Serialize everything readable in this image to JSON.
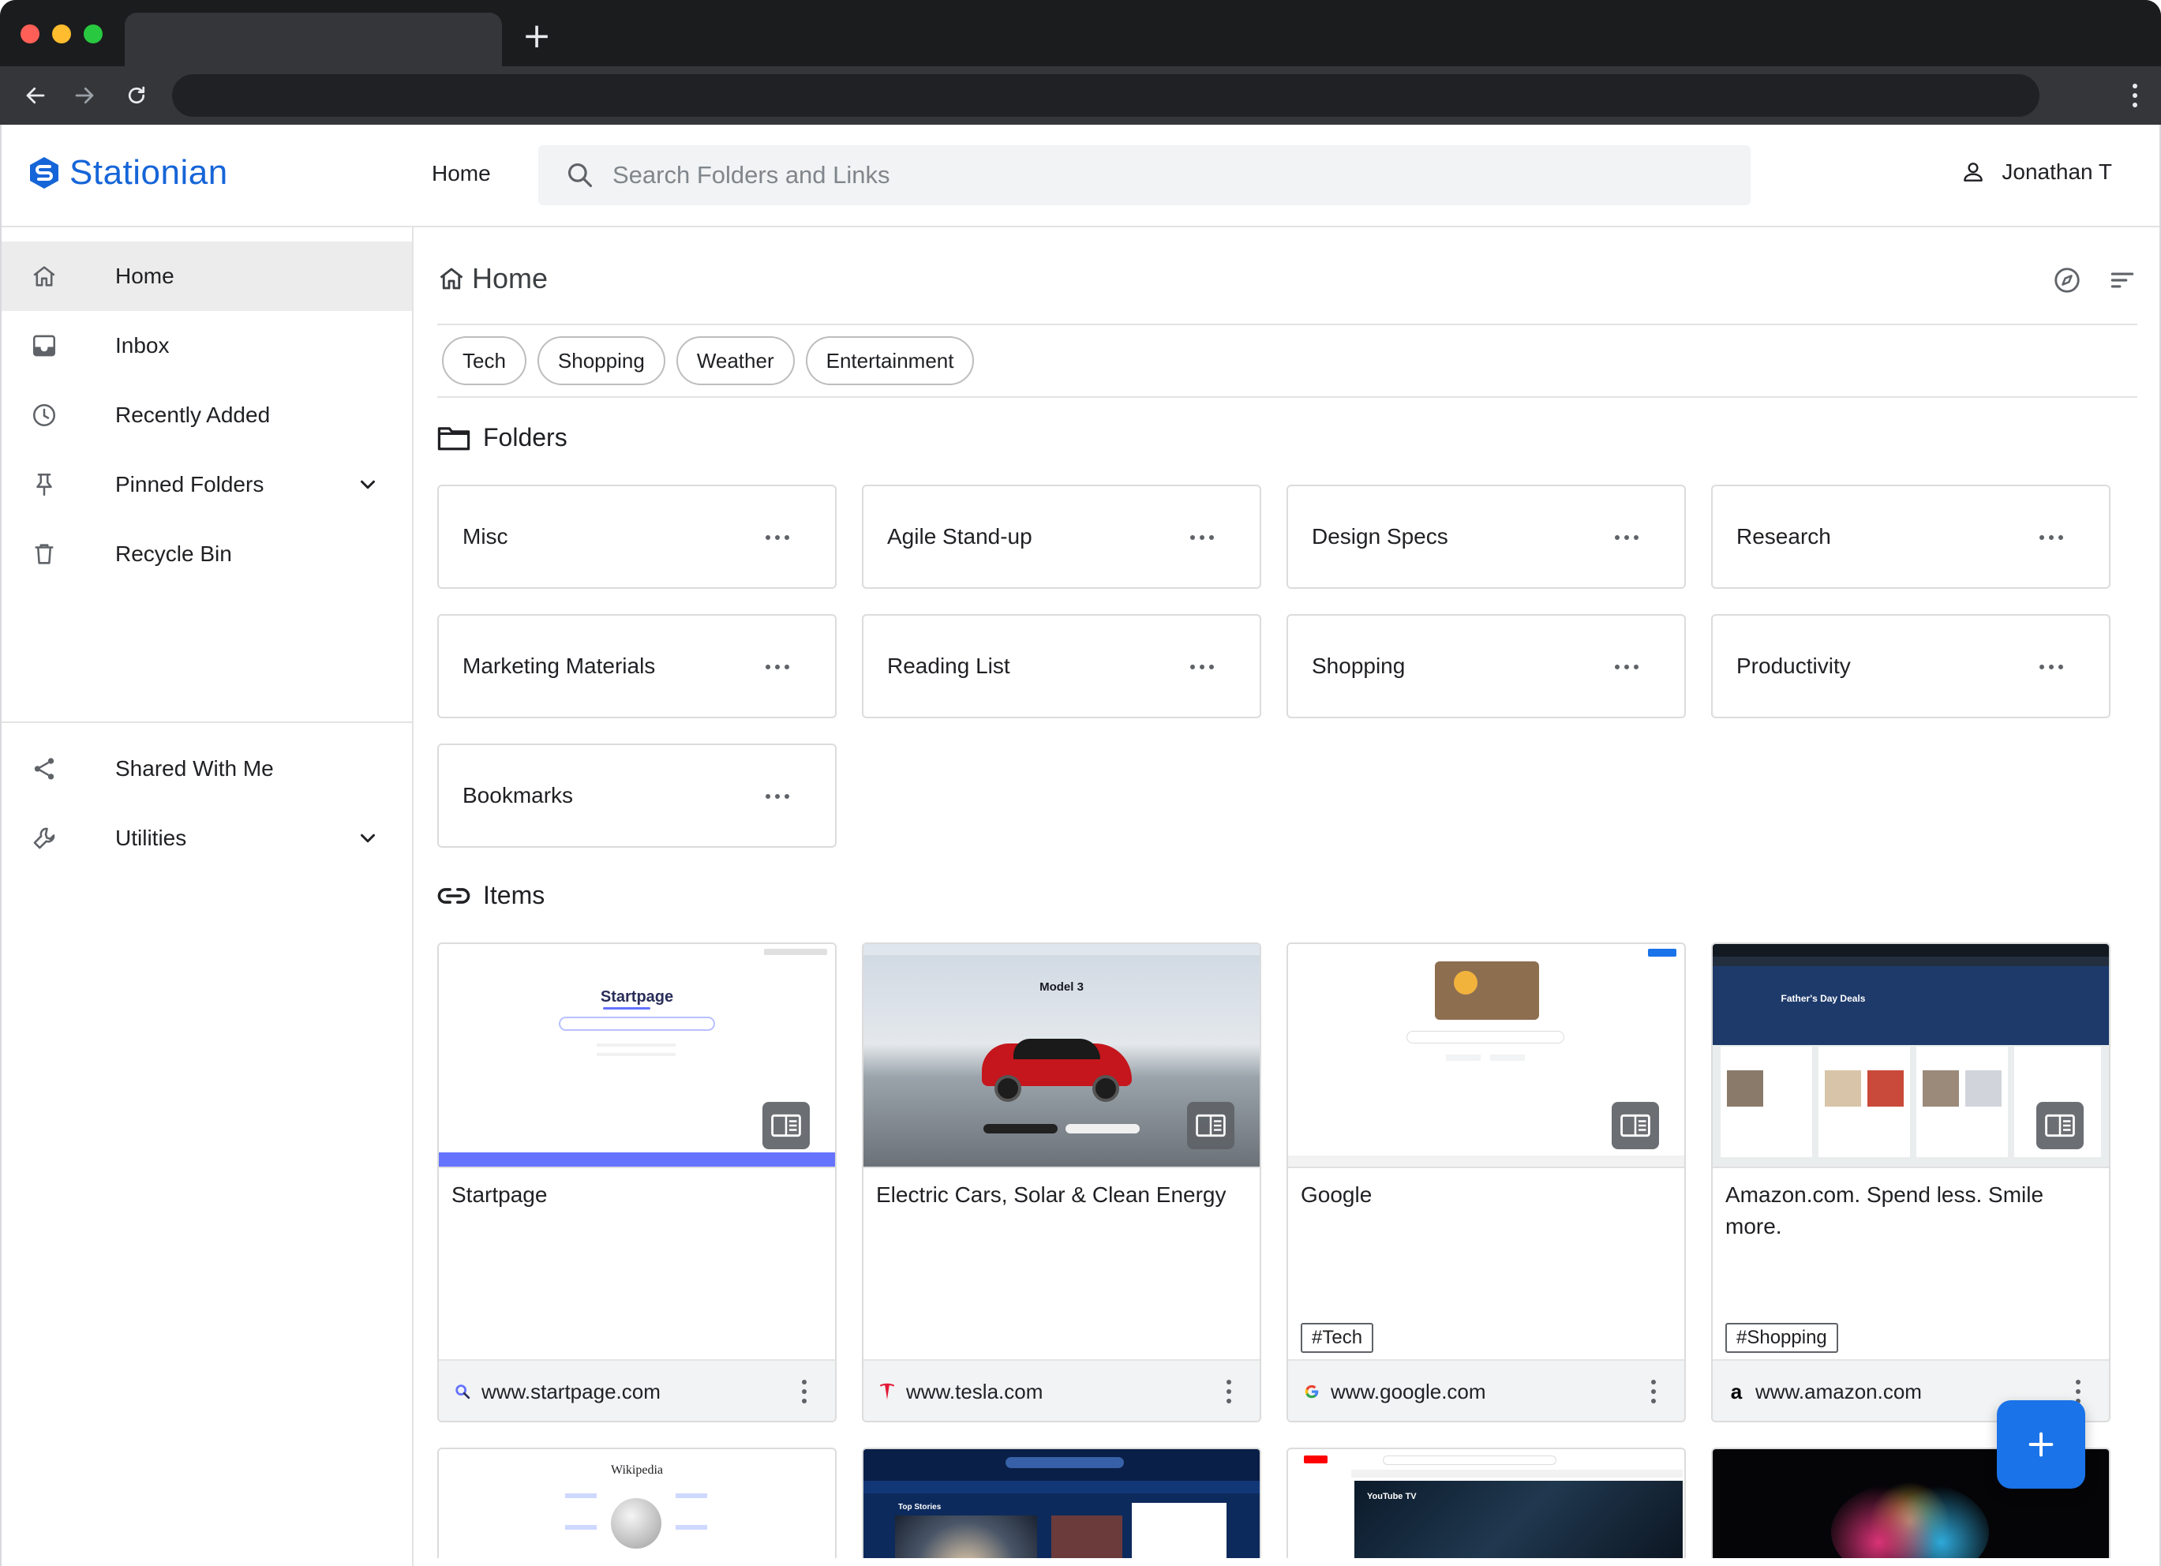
{
  "app": {
    "name": "Stationian",
    "accent": "#1665d8"
  },
  "header": {
    "nav_home": "Home",
    "search_placeholder": "Search Folders and Links",
    "user_name": "Jonathan T"
  },
  "sidebar": {
    "items": [
      {
        "label": "Home",
        "icon": "home-icon",
        "active": true
      },
      {
        "label": "Inbox",
        "icon": "inbox-icon"
      },
      {
        "label": "Recently Added",
        "icon": "clock-icon"
      },
      {
        "label": "Pinned Folders",
        "icon": "pin-icon",
        "expandable": true
      },
      {
        "label": "Recycle Bin",
        "icon": "trash-icon"
      },
      {
        "label": "Shared With Me",
        "icon": "share-icon"
      },
      {
        "label": "Utilities",
        "icon": "wrench-icon",
        "expandable": true
      }
    ]
  },
  "main": {
    "title": "Home",
    "chips": [
      "Tech",
      "Shopping",
      "Weather",
      "Entertainment"
    ],
    "folders_title": "Folders",
    "folders": [
      "Misc",
      "Agile Stand-up",
      "Design Specs",
      "Research",
      "Marketing Materials",
      "Reading List",
      "Shopping",
      "Productivity",
      "Bookmarks"
    ],
    "items_title": "Items",
    "items": [
      {
        "title": "Startpage",
        "url": "www.startpage.com",
        "tag": "",
        "thumb_text": "Startpage"
      },
      {
        "title": "Electric Cars, Solar & Clean Energy",
        "url": "www.tesla.com",
        "tag": "",
        "thumb_text": "Model 3"
      },
      {
        "title": "Google",
        "url": "www.google.com",
        "tag": "#Tech",
        "thumb_text": ""
      },
      {
        "title": "Amazon.com. Spend less. Smile more.",
        "url": "www.amazon.com",
        "tag": "#Shopping",
        "thumb_text": "Father's Day Deals"
      }
    ],
    "partial_items": [
      {
        "thumb_text": "Wikipedia"
      },
      {
        "thumb_text": "Top Stories"
      },
      {
        "thumb_text": "YouTube TV"
      },
      {
        "thumb_text": ""
      }
    ]
  }
}
